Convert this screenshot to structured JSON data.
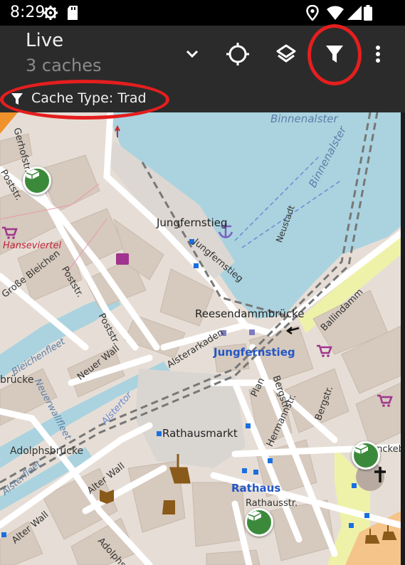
{
  "status": {
    "time": "8:29"
  },
  "appbar": {
    "title": "Live",
    "subtitle": "3 caches"
  },
  "filter": {
    "label": "Cache Type: Trad"
  },
  "map": {
    "water_labels": [
      "Binnenalster",
      "Binnenalster",
      "Bleichenfleet",
      "Neuerwallfleet",
      "Alsterfleet"
    ],
    "street_labels": [
      "Gerhofstr.",
      "Poststr.",
      "Poststr.",
      "Poststr.",
      "Große Bleichen",
      "Jungfernstieg",
      "Neustadt",
      "Ballindamm",
      "Alsterarkaden",
      "Neuer Wall",
      "Bergstr.",
      "Plan",
      "Hermannstr.",
      "Bergstr.",
      "Alter Wall",
      "Alter Wall",
      "Adolphspl.",
      "Alstertor",
      "Rathausstr.",
      "Mönckeb"
    ],
    "place_labels": [
      "Jungfernstieg",
      "Reesendammbrücke",
      "Rathausmarkt",
      "Adolphsbrücke",
      "brücke"
    ],
    "stop_labels": [
      "Jungfernstieg",
      "Rathaus"
    ],
    "district_labels": [
      "Hanseviertel"
    ],
    "cache_count": 3
  }
}
